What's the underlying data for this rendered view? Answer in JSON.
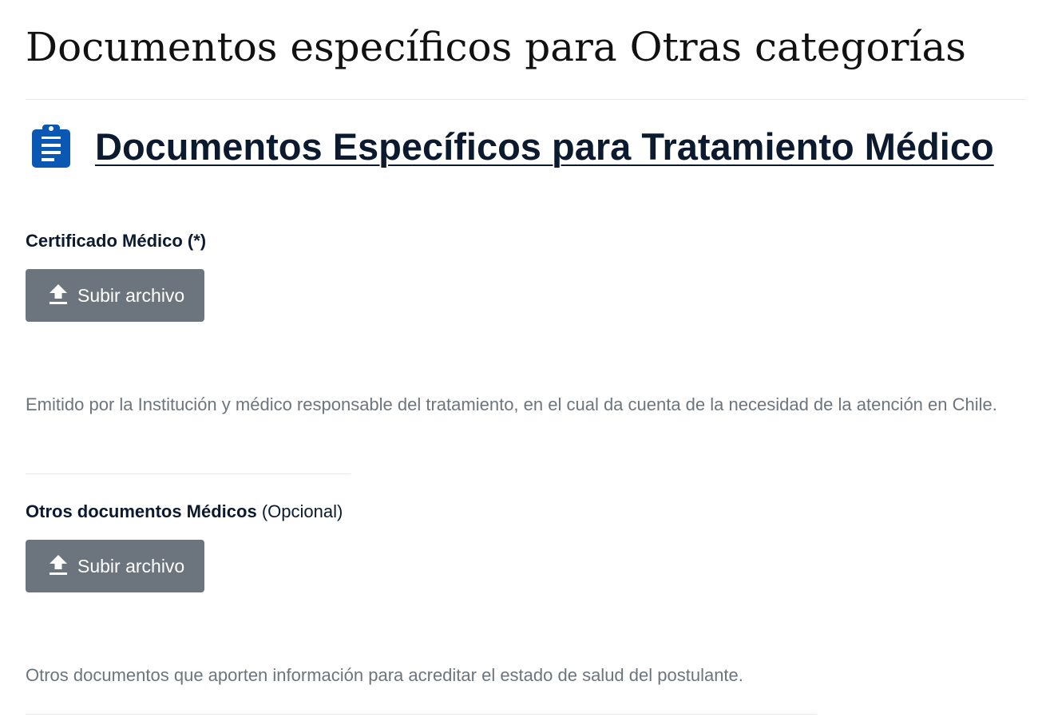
{
  "page_title": "Documentos específicos para Otras categorías",
  "section": {
    "icon": "clipboard-icon",
    "title": "Documentos Específicos para Tratamiento Médico"
  },
  "fields": [
    {
      "label": "Certificado Médico (*)",
      "optional_text": "",
      "button_label": "Subir archivo",
      "button_icon": "upload-icon",
      "help": "Emitido por la Institución y médico responsable del tratamiento, en el cual da cuenta de la necesidad de la atención en Chile."
    },
    {
      "label": "Otros documentos Médicos",
      "optional_text": "(Opcional)",
      "button_label": "Subir archivo",
      "button_icon": "upload-icon",
      "help": "Otros documentos que aporten información para acreditar el estado de salud del postulante."
    }
  ],
  "colors": {
    "button_bg": "#6c757d",
    "icon_blue": "#0b58b4",
    "heading": "#0b1a2e",
    "help_text": "#6c757d"
  }
}
